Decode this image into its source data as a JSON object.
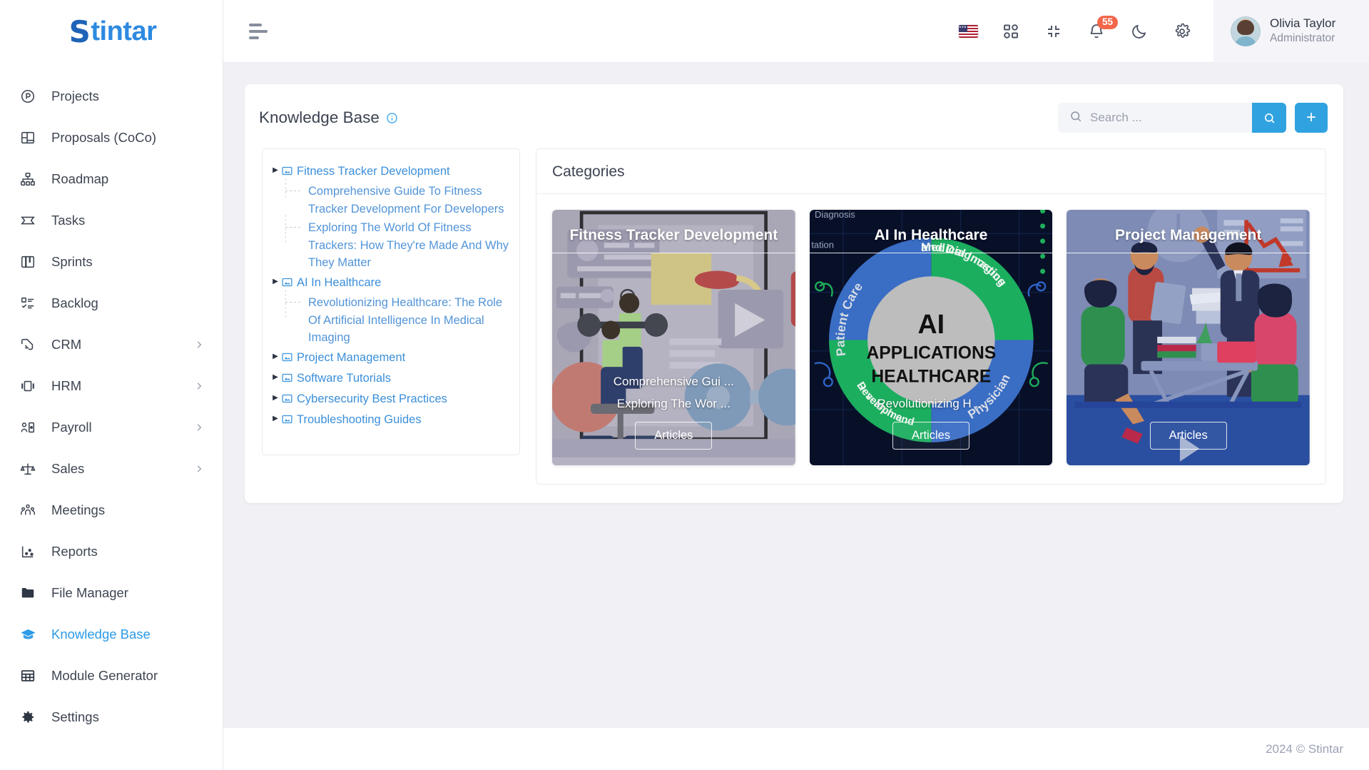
{
  "brand": {
    "logo_first": "S",
    "logo_rest": "tintar"
  },
  "sidebar": {
    "items": [
      {
        "label": "Projects",
        "icon": "circle-p-icon",
        "expandable": false,
        "active": false
      },
      {
        "label": "Proposals (CoCo)",
        "icon": "layout-proposal-icon",
        "expandable": false,
        "active": false
      },
      {
        "label": "Roadmap",
        "icon": "hierarchy-icon",
        "expandable": false,
        "active": false
      },
      {
        "label": "Tasks",
        "icon": "ticket-icon",
        "expandable": false,
        "active": false
      },
      {
        "label": "Sprints",
        "icon": "board-icon",
        "expandable": false,
        "active": false
      },
      {
        "label": "Backlog",
        "icon": "checklist-icon",
        "expandable": false,
        "active": false
      },
      {
        "label": "CRM",
        "icon": "handshake-icon",
        "expandable": true,
        "active": false
      },
      {
        "label": "HRM",
        "icon": "slides-icon",
        "expandable": true,
        "active": false
      },
      {
        "label": "Payroll",
        "icon": "person-card-icon",
        "expandable": true,
        "active": false
      },
      {
        "label": "Sales",
        "icon": "scales-icon",
        "expandable": true,
        "active": false
      },
      {
        "label": "Meetings",
        "icon": "people-group-icon",
        "expandable": false,
        "active": false
      },
      {
        "label": "Reports",
        "icon": "scatter-chart-icon",
        "expandable": false,
        "active": false
      },
      {
        "label": "File Manager",
        "icon": "folder-icon",
        "expandable": false,
        "active": false
      },
      {
        "label": "Knowledge Base",
        "icon": "graduation-cap-icon",
        "expandable": false,
        "active": true
      },
      {
        "label": "Module Generator",
        "icon": "grid-table-icon",
        "expandable": false,
        "active": false
      },
      {
        "label": "Settings",
        "icon": "gear-icon",
        "expandable": false,
        "active": false
      }
    ],
    "caret_glyph": "›"
  },
  "topbar": {
    "menu_toggle": "hamburger-icon",
    "icons": [
      {
        "name": "language-flag-us",
        "label": "US"
      },
      {
        "name": "apps-grid-icon"
      },
      {
        "name": "collapse-fullscreen-icon"
      },
      {
        "name": "notifications-bell-icon",
        "badge": "55"
      },
      {
        "name": "dark-mode-moon-icon"
      },
      {
        "name": "settings-gear-icon"
      }
    ],
    "user": {
      "name": "Olivia Taylor",
      "role": "Administrator"
    }
  },
  "page": {
    "title": "Knowledge Base",
    "info_glyph": "i",
    "search": {
      "placeholder": "Search ...",
      "value": ""
    },
    "search_button": "search-icon",
    "add_button": "+"
  },
  "tree": [
    {
      "label": "Fitness Tracker Development",
      "children": [
        "Comprehensive Guide To Fitness Tracker Development For Developers",
        "Exploring The World Of Fitness Trackers: How They're Made And Why They Matter"
      ]
    },
    {
      "label": "AI In Healthcare",
      "children": [
        "Revolutionizing Healthcare: The Role Of Artificial Intelligence In Medical Imaging"
      ]
    },
    {
      "label": "Project Management",
      "children": []
    },
    {
      "label": "Software Tutorials",
      "children": []
    },
    {
      "label": "Cybersecurity Best Practices",
      "children": []
    },
    {
      "label": "Troubleshooting Guides",
      "children": []
    }
  ],
  "categories": {
    "heading": "Categories",
    "cards": [
      {
        "title": "Fitness Tracker Development",
        "links": [
          "Comprehensive Gui ...",
          "Exploring The Wor ..."
        ],
        "button": "Articles"
      },
      {
        "title": "AI In Healthcare",
        "links": [
          "Revolutionizing H ..."
        ],
        "button": "Articles",
        "art_labels": {
          "center_line1": "AI",
          "center_line2": "APPLICATIONS",
          "center_line3": "HEALTHCARE",
          "quad_tl": "Patient Care",
          "quad_tr": "Medical Imaging and Diagnostics",
          "quad_bl": "Research and Development",
          "quad_br": "Physician",
          "edge_top": "Diagnosis",
          "edge_top2": "tation"
        }
      },
      {
        "title": "Project Management",
        "links": [],
        "button": "Articles"
      }
    ]
  },
  "footer": {
    "copyright": "2024 © Stintar"
  },
  "colors": {
    "accent": "#31a2e0",
    "brand_dark": "#1f63b8",
    "badge": "#f2674a",
    "tree_link": "#3b8fda",
    "page_bg": "#f1f0f5"
  }
}
